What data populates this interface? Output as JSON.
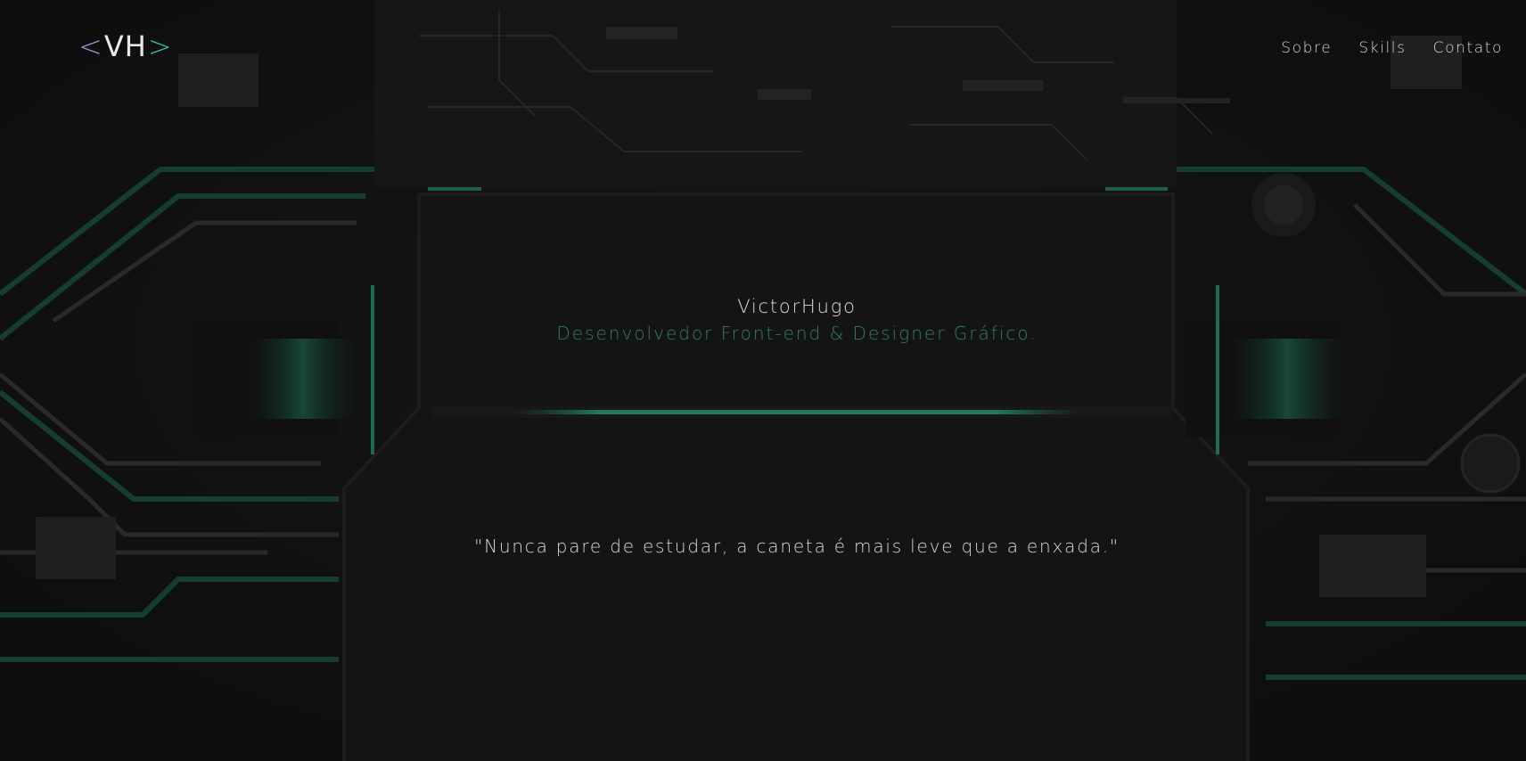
{
  "header": {
    "logo": {
      "left_chevron": "<",
      "letters": "VH",
      "right_chevron": ">"
    },
    "nav": [
      {
        "label": "Sobre"
      },
      {
        "label": "Skills"
      },
      {
        "label": "Contato"
      }
    ]
  },
  "hero": {
    "name": "VictorHugo",
    "role": "Desenvolvedor Front-end & Designer Gráfico."
  },
  "quote": {
    "text": "\"Nunca pare de estudar, a caneta é mais leve que a enxada.\""
  },
  "colors": {
    "background": "#121212",
    "accent_green": "#2f7f68",
    "logo_purple": "#a38fd6",
    "logo_teal": "#2cc4a6",
    "text": "#d9d9d9"
  }
}
